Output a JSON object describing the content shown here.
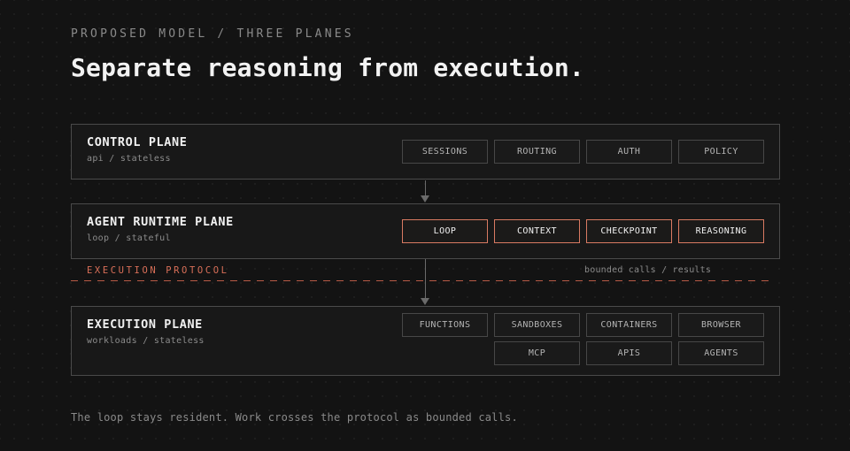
{
  "header": {
    "eyebrow": "PROPOSED MODEL / THREE PLANES",
    "title": "Separate reasoning from execution."
  },
  "planes": {
    "control": {
      "name": "CONTROL PLANE",
      "subtitle": "api / stateless",
      "components": [
        "SESSIONS",
        "ROUTING",
        "AUTH",
        "POLICY"
      ]
    },
    "runtime": {
      "name": "AGENT RUNTIME PLANE",
      "subtitle": "loop / stateful",
      "components": [
        "LOOP",
        "CONTEXT",
        "CHECKPOINT",
        "REASONING"
      ]
    },
    "execution": {
      "name": "EXECUTION PLANE",
      "subtitle": "workloads / stateless",
      "components": [
        "FUNCTIONS",
        "SANDBOXES",
        "CONTAINERS",
        "BROWSER",
        "MCP",
        "APIS",
        "AGENTS"
      ]
    }
  },
  "protocol": {
    "label": "EXECUTION PROTOCOL",
    "note": "bounded calls / results"
  },
  "footer": {
    "caption": "The loop stays resident. Work crosses the protocol as bounded calls."
  },
  "colors": {
    "background": "#131313",
    "accent": "#d97a62",
    "protocol": "#d96f58"
  }
}
